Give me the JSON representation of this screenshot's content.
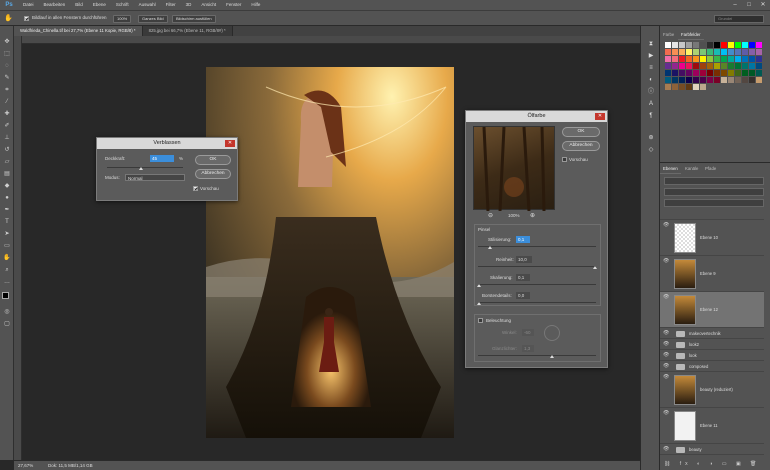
{
  "app": {
    "logo": "Ps"
  },
  "menubar": [
    "Datei",
    "Bearbeiten",
    "Bild",
    "Ebene",
    "Schrift",
    "Auswahl",
    "Filter",
    "3D",
    "Ansicht",
    "Fenster",
    "Hilfe"
  ],
  "window_controls": [
    "–",
    "□",
    "✕"
  ],
  "options": {
    "sample_all_label": "Bildlauf in allen Fenstern durchführen",
    "zoom_button": "100%",
    "full_image_button": "Ganzes Bild",
    "fill_screen_button": "Bildschirm ausfüllen",
    "search_placeholder": "Grundei"
  },
  "tabs": [
    {
      "label": "Waldfrieda_Chinella.tif bei 27,7% (Ebene 11 Kopie, RGB/8) *",
      "active": true
    },
    {
      "label": "825.jpg bei 66,7% (Ebene 11, RGB/8#) *",
      "active": false
    }
  ],
  "status": {
    "zoom": "27,67%",
    "doc": "Dok: 11,5 MB/1,14 GB"
  },
  "panels": {
    "swatch_tabs": [
      "Farbe",
      "Farbfelder"
    ],
    "layer_tabs": [
      "Ebenen",
      "Kanäle",
      "Pfade"
    ]
  },
  "swatch_colors": [
    "#ffffff",
    "#e6e6e6",
    "#c8c8c8",
    "#a0a0a0",
    "#787878",
    "#505050",
    "#2c2c2c",
    "#000000",
    "#ff0000",
    "#ffff00",
    "#00ff00",
    "#00ffff",
    "#0000ff",
    "#ff00ff",
    "#f26c4f",
    "#f68e55",
    "#fbaf5c",
    "#fff467",
    "#acd372",
    "#7cc576",
    "#3bb878",
    "#1abbb4",
    "#00bff3",
    "#438ccb",
    "#5574b9",
    "#605ca8",
    "#855fa8",
    "#a763a8",
    "#f06eaa",
    "#f26d7d",
    "#ed1c24",
    "#f26522",
    "#f7941d",
    "#fff200",
    "#8dc63f",
    "#39b54a",
    "#00a651",
    "#00a99d",
    "#00aeef",
    "#0072bc",
    "#0054a6",
    "#2e3192",
    "#662d91",
    "#92278f",
    "#ec008c",
    "#ed145b",
    "#9e0b0f",
    "#a0410d",
    "#a36209",
    "#aba000",
    "#598527",
    "#197b30",
    "#007236",
    "#00746b",
    "#0076a3",
    "#004a80",
    "#003471",
    "#1b1464",
    "#440e62",
    "#630460",
    "#9e005d",
    "#9e0039",
    "#790000",
    "#7b2e00",
    "#7d4900",
    "#827b00",
    "#406618",
    "#005e20",
    "#005826",
    "#005952",
    "#005b7f",
    "#003663",
    "#002157",
    "#0d004c",
    "#32004b",
    "#4b0049",
    "#7b0046",
    "#7a0026",
    "#c7b299",
    "#998675",
    "#736357",
    "#534741",
    "#37302d",
    "#c69c6d",
    "#a67c52",
    "#8c6239",
    "#754c24",
    "#603913",
    "#e0d3bd",
    "#bba98d"
  ],
  "layers": [
    {
      "name": "",
      "kind": "folder-row"
    },
    {
      "name": "Ebene 10",
      "kind": "big",
      "thumb": "transparent"
    },
    {
      "name": "Ebene 9",
      "kind": "big",
      "thumb": "photo"
    },
    {
      "name": "Ebene 12",
      "kind": "big",
      "thumb": "photo",
      "selected": true
    },
    {
      "name": "makeovertechnik",
      "kind": "folder"
    },
    {
      "name": "look2",
      "kind": "folder"
    },
    {
      "name": "look",
      "kind": "folder"
    },
    {
      "name": "composed",
      "kind": "folder"
    },
    {
      "name": "beauty (reduziert)",
      "kind": "big",
      "thumb": "photo"
    },
    {
      "name": "Ebene 11",
      "kind": "big",
      "thumb": "sketch"
    },
    {
      "name": "beauty",
      "kind": "folder"
    }
  ],
  "dialogs": {
    "fade": {
      "title": "Verblassen",
      "opacity_label": "Deckkraft:",
      "opacity_value": "45",
      "opacity_unit": "%",
      "opacity_pct": 45,
      "mode_label": "Modus:",
      "mode_value": "Normal",
      "ok": "OK",
      "cancel": "Abbrechen",
      "preview": "Vorschau"
    },
    "oil": {
      "title": "Ölfarbe",
      "ok": "OK",
      "cancel": "Abbrechen",
      "preview": "Vorschau",
      "zoom": "100%",
      "brush_section": "Pinsel",
      "stylization_label": "Stilisierung:",
      "stylization_value": "0,1",
      "cleanliness_label": "Reinheit:",
      "cleanliness_value": "10,0",
      "scale_label": "Skalierung:",
      "scale_value": "0,1",
      "bristle_label": "Borstendetails:",
      "bristle_value": "0,0",
      "lighting_section": "Beleuchtung",
      "angle_label": "Winkel:",
      "angle_value": "-60",
      "shine_label": "Glanzlichter:",
      "shine_value": "1,3"
    }
  }
}
